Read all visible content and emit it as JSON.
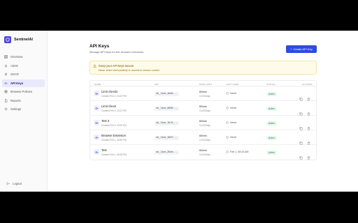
{
  "brand": {
    "name": "SentinelAI",
    "logo_icon": "shield-icon",
    "accent": "#4f46e5"
  },
  "sidebar": {
    "items": [
      {
        "label": "Overview",
        "icon": "grid-icon",
        "active": false
      },
      {
        "label": "Alerts",
        "icon": "bell-icon",
        "active": false
      },
      {
        "label": "SOAR",
        "icon": "zap-icon",
        "active": false
      },
      {
        "label": "API Keys",
        "icon": "key-icon",
        "active": true
      },
      {
        "label": "Browser Policies",
        "icon": "globe-icon",
        "active": false
      },
      {
        "label": "Reports",
        "icon": "file-icon",
        "active": false
      },
      {
        "label": "Settings",
        "icon": "gear-icon",
        "active": false
      }
    ],
    "logout_label": "Logout"
  },
  "page": {
    "title": "API Keys",
    "subtitle": "Manage API keys for the browser extension",
    "create_button": "Create API Key"
  },
  "warning": {
    "title": "Keep your API keys secure",
    "text": "Never share them publicly or commit to version control"
  },
  "table": {
    "headers": [
      "NAME",
      "KEY",
      "RATE LIMIT",
      "LAST USED",
      "STATUS",
      "ACTIONS"
    ],
    "rows": [
      {
        "name": "Limit check2",
        "created": "Created Feb 2, 03:22 PM",
        "key": "sk_live_ibd3...",
        "rate_min": "60/min",
        "rate_day": "10,000/day",
        "last_used": "Never",
        "status": "Active"
      },
      {
        "name": "Limit check",
        "created": "Created Feb 2, 03:21 PM",
        "key": "sk_live_d058...",
        "rate_min": "60/min",
        "rate_day": "10,000/day",
        "last_used": "Never",
        "status": "Active"
      },
      {
        "name": "Test 3",
        "created": "Created Feb 2, 03:00 PM",
        "key": "sk_live_7b74...",
        "rate_min": "60/min",
        "rate_day": "10,000/day",
        "last_used": "Never",
        "status": "Active"
      },
      {
        "name": "Browser Extension",
        "created": "Created Feb 1, 08:49 PM",
        "key": "sk_live_1837...",
        "rate_min": "60/min",
        "rate_day": "10,000/day",
        "last_used": "Never",
        "status": "Active"
      },
      {
        "name": "Test",
        "created": "Created Feb 1, 08:38 PM",
        "key": "sk_live_25ed...",
        "rate_min": "60/min",
        "rate_day": "10,000/day",
        "last_used": "Feb 1, 08:43 AM",
        "status": "Active"
      }
    ]
  }
}
